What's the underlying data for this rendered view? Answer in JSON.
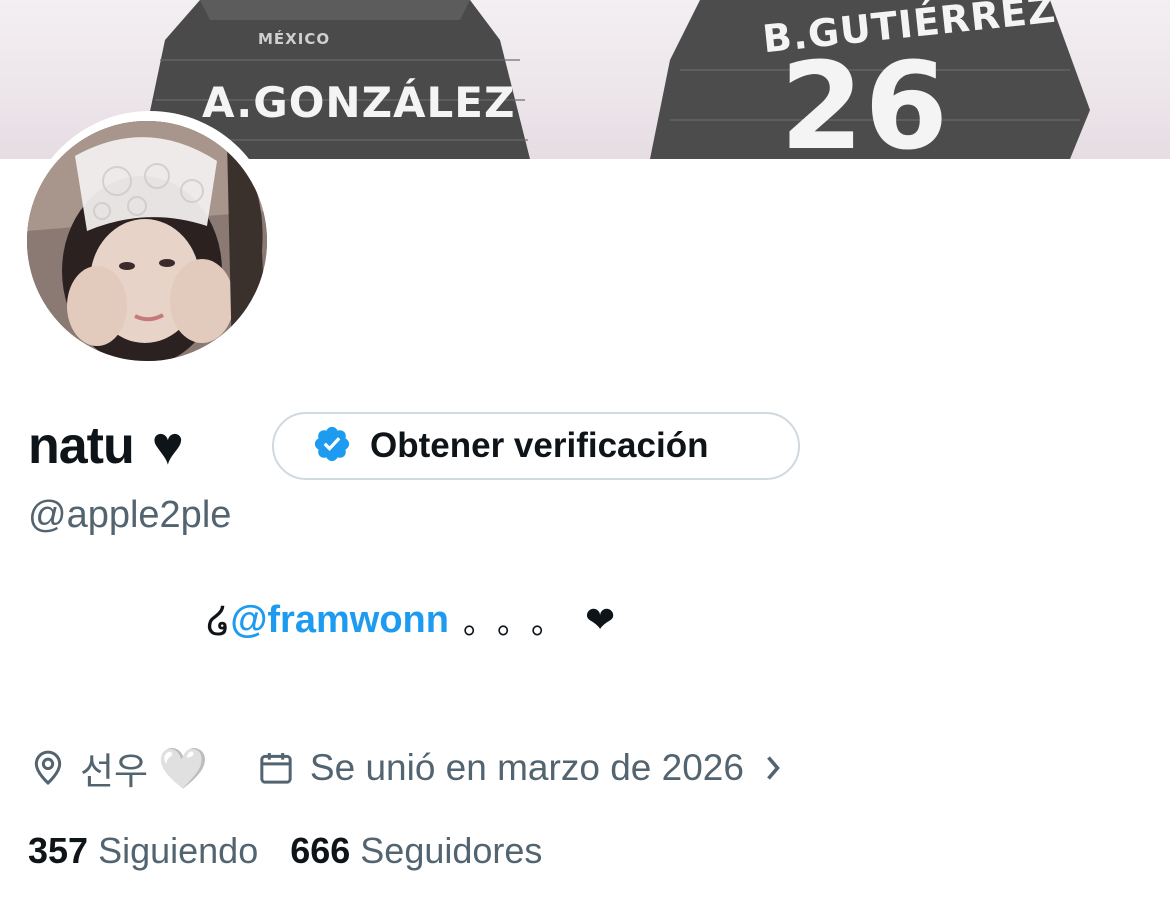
{
  "banner": {
    "jersey_left_name": "A.GONZÁLEZ",
    "jersey_left_crest": "MÉXICO",
    "jersey_right_name": "B.GUTIÉRREZ",
    "jersey_right_number": "26"
  },
  "profile": {
    "display_name": "natu",
    "name_emoji": "♥",
    "handle": "@apple2ple",
    "verify_button_label": "Obtener verificación",
    "bio": {
      "prefix": "໒",
      "mention": "@framwonn",
      "dots": "。。。",
      "emoji": "❤"
    },
    "location": "선우",
    "location_emoji": "🤍",
    "joined": "Se unió en marzo de 2026",
    "following_count": "357",
    "following_label": "Siguiendo",
    "followers_count": "666",
    "followers_label": "Seguidores"
  },
  "colors": {
    "accent": "#1d9bf0",
    "secondary_text": "#536471",
    "primary_text": "#0f1419",
    "border": "#cfd9de"
  },
  "icons": {
    "location": "location-pin-icon",
    "calendar": "calendar-icon",
    "verified": "verified-badge-icon",
    "chevron": "chevron-right-icon"
  }
}
